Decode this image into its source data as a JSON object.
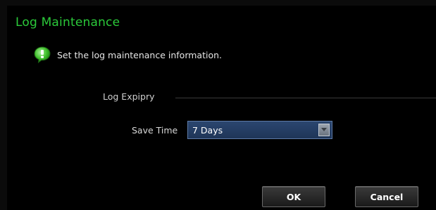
{
  "dialog": {
    "title": "Log Maintenance",
    "info_text": "Set the log maintenance information.",
    "info_icon": "info-bubble-icon",
    "accent_color": "#2bc93a"
  },
  "log_expiry": {
    "section_label": "Log Expipry",
    "save_time_label": "Save Time",
    "save_time_value": "7 Days"
  },
  "buttons": {
    "ok_label": "OK",
    "cancel_label": "Cancel"
  }
}
